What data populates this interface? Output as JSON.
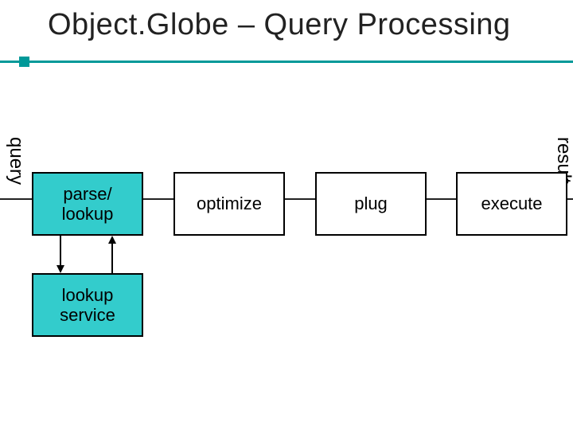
{
  "title": "Object.Globe – Query Processing",
  "labels": {
    "query": "query",
    "result": "result"
  },
  "boxes": {
    "parse_lookup_line1": "parse/",
    "parse_lookup_line2": "lookup",
    "optimize": "optimize",
    "plug": "plug",
    "execute": "execute",
    "lookup_service_line1": "lookup",
    "lookup_service_line2": "service"
  },
  "chart_data": {
    "type": "diagram",
    "title": "Object.Globe – Query Processing",
    "nodes": [
      {
        "id": "parse_lookup",
        "label": "parse/ lookup",
        "highlighted": true
      },
      {
        "id": "optimize",
        "label": "optimize",
        "highlighted": false
      },
      {
        "id": "plug",
        "label": "plug",
        "highlighted": false
      },
      {
        "id": "execute",
        "label": "execute",
        "highlighted": false
      },
      {
        "id": "lookup_service",
        "label": "lookup service",
        "highlighted": true
      }
    ],
    "flow": [
      "query",
      "parse_lookup",
      "optimize",
      "plug",
      "execute",
      "result"
    ],
    "edges": [
      {
        "from": "parse_lookup",
        "to": "lookup_service",
        "bidirectional": true
      }
    ],
    "highlight_color": "#33cccc"
  }
}
